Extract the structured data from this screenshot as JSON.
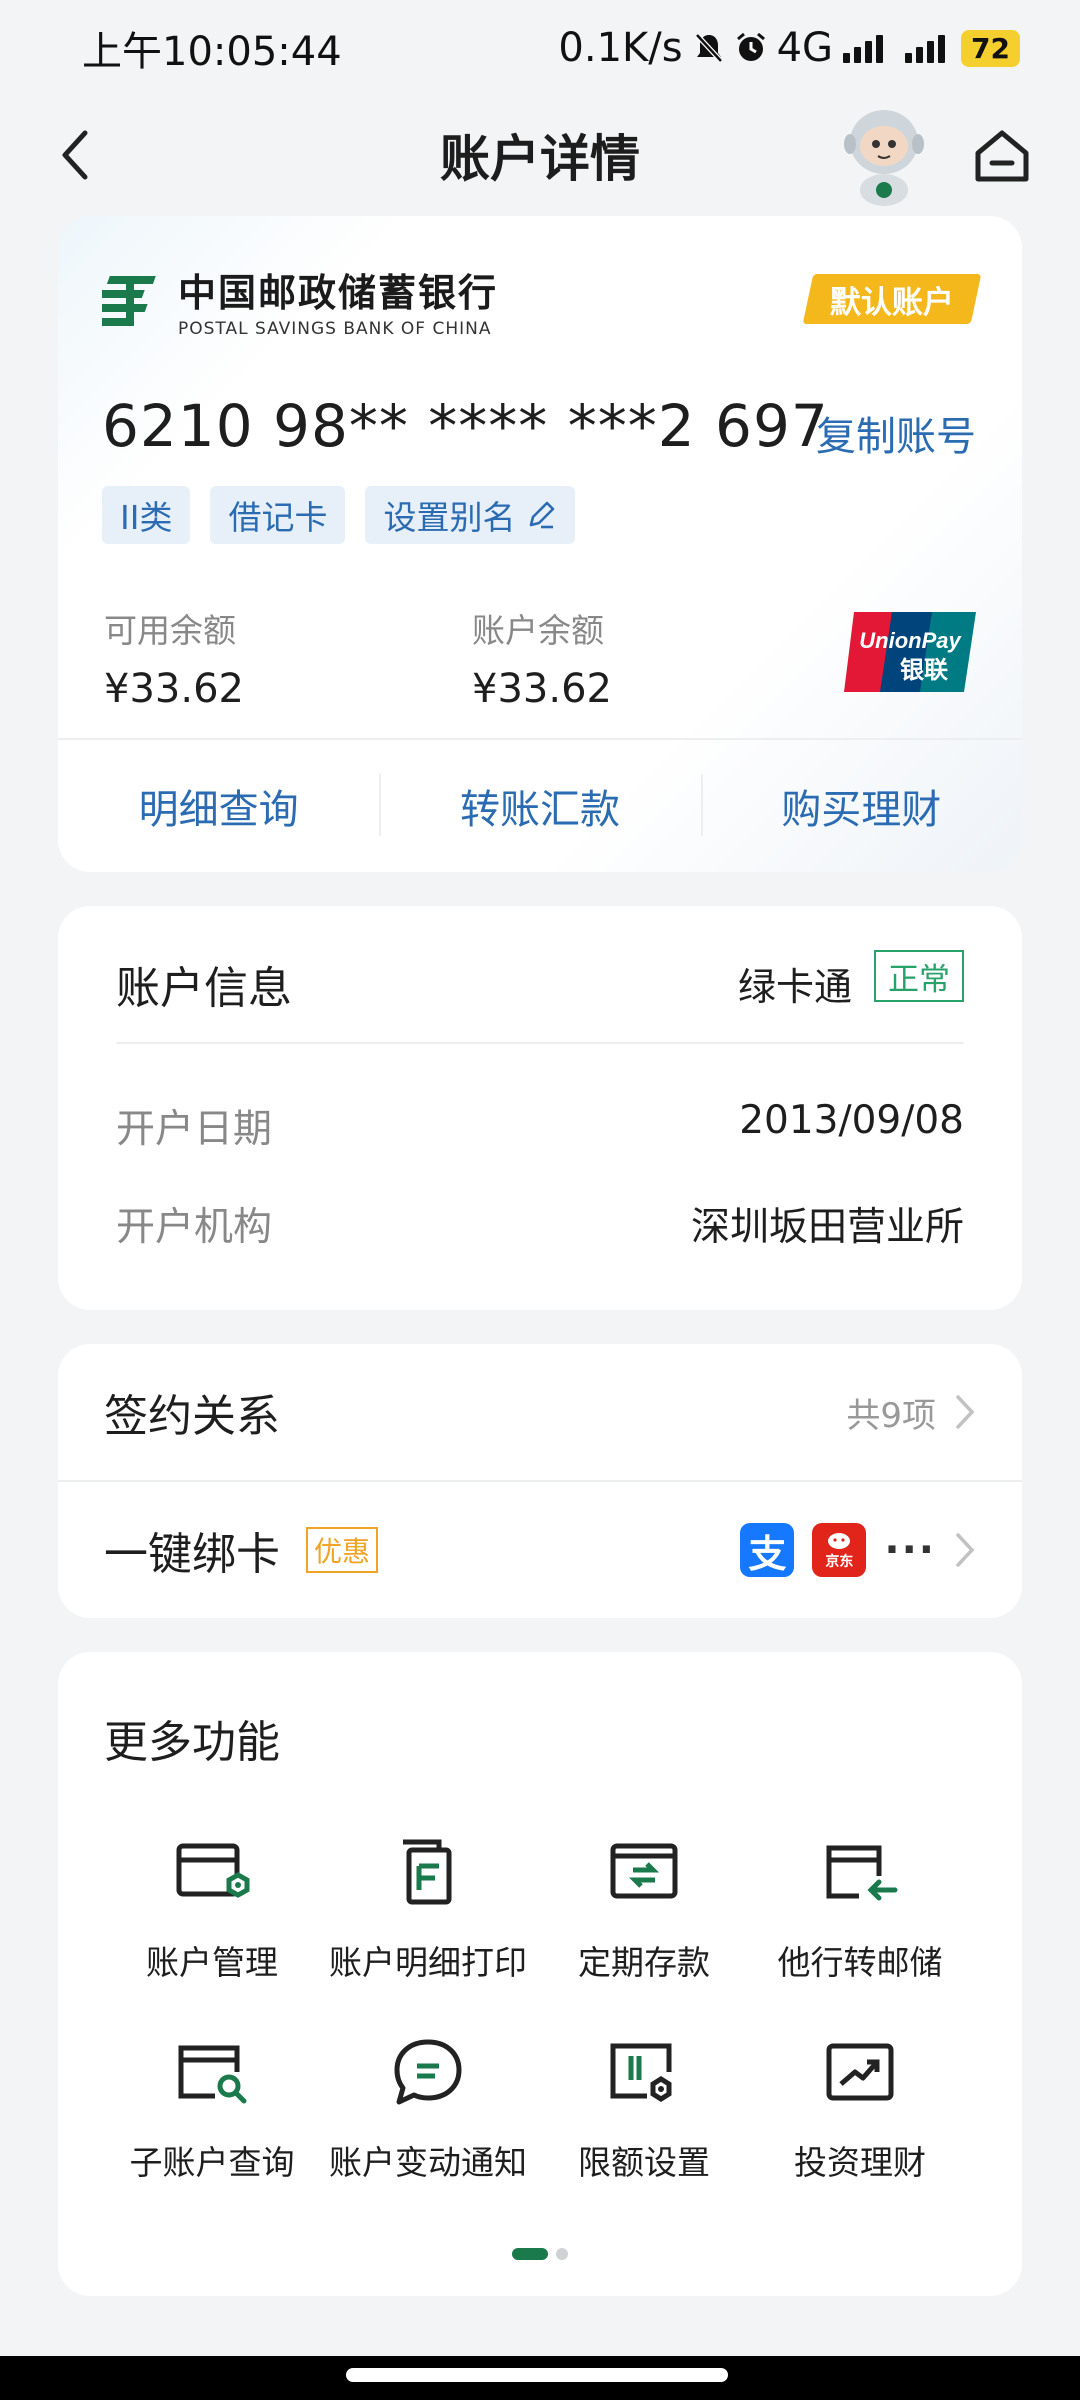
{
  "status_bar": {
    "time": "上午10:05:44",
    "net_speed": "0.1K/s",
    "network": "4G",
    "battery": "72"
  },
  "header": {
    "title": "账户详情"
  },
  "account_card": {
    "bank_name_cn": "中国邮政储蓄银行",
    "bank_name_en": "POSTAL SAVINGS BANK OF CHINA",
    "default_badge": "默认账户",
    "account_number": "6210 98** **** ***2 697",
    "copy_label": "复制账号",
    "tags": [
      "II类",
      "借记卡",
      "设置别名"
    ],
    "available_balance_label": "可用余额",
    "available_balance": "¥33.62",
    "account_balance_label": "账户余额",
    "account_balance": "¥33.62",
    "unionpay_text_1": "UnionPay",
    "unionpay_text_2": "银联",
    "actions": [
      "明细查询",
      "转账汇款",
      "购买理财"
    ]
  },
  "account_info": {
    "title": "账户信息",
    "type": "绿卡通",
    "status": "正常",
    "open_date_label": "开户日期",
    "open_date": "2013/09/08",
    "branch_label": "开户机构",
    "branch": "深圳坂田营业所"
  },
  "sign": {
    "relation_label": "签约关系",
    "relation_count": "共9项",
    "bind_label": "一键绑卡",
    "promo": "优惠",
    "alipay_glyph": "支",
    "jd_text": "京东",
    "more": "···"
  },
  "more_functions": {
    "title": "更多功能",
    "items": [
      {
        "label": "账户管理",
        "icon": "account-manage-icon"
      },
      {
        "label": "账户明细打印",
        "icon": "print-detail-icon"
      },
      {
        "label": "定期存款",
        "icon": "fixed-deposit-icon"
      },
      {
        "label": "他行转邮储",
        "icon": "transfer-in-icon"
      },
      {
        "label": "子账户查询",
        "icon": "sub-account-search-icon"
      },
      {
        "label": "账户变动通知",
        "icon": "notification-icon"
      },
      {
        "label": "限额设置",
        "icon": "limit-settings-icon"
      },
      {
        "label": "投资理财",
        "icon": "investment-icon"
      }
    ]
  },
  "colors": {
    "accent_blue": "#2b6bb2",
    "brand_green": "#1a7a4c",
    "badge_yellow": "#f4b71c",
    "status_green": "#27a36a",
    "promo_orange": "#f0a324"
  }
}
